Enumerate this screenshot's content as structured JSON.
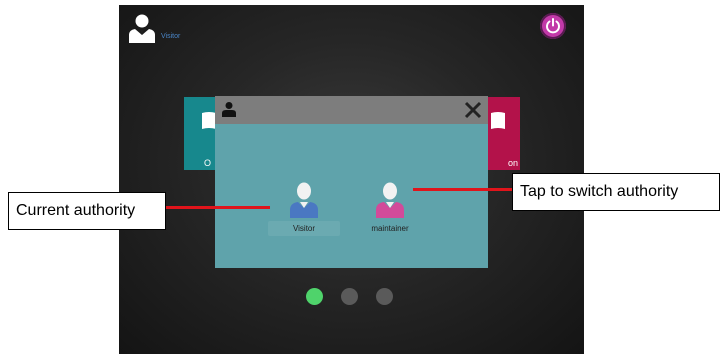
{
  "screen": {
    "current_user": {
      "name": "Visitor",
      "icon": "user-icon"
    },
    "power": {
      "icon": "power-icon",
      "color": "#c239a8"
    },
    "tiles": [
      {
        "label": "O",
        "icon": "book-icon",
        "color": "#17888d"
      },
      {
        "label": "on",
        "icon": "book-icon",
        "color": "#b3124a"
      }
    ],
    "dialog": {
      "header_icon": "user-icon",
      "close_icon": "close-icon",
      "roles": [
        {
          "label": "Visitor",
          "color": "#4a78c2"
        },
        {
          "label": "maintainer",
          "color": "#d24a9a"
        }
      ]
    },
    "pager": {
      "pages": 3,
      "active_page": 1,
      "active_color": "#4fd36b"
    }
  },
  "annotations": {
    "left_callout": "Current authority",
    "right_callout": "Tap to switch authority",
    "line_color": "#e0141b"
  }
}
